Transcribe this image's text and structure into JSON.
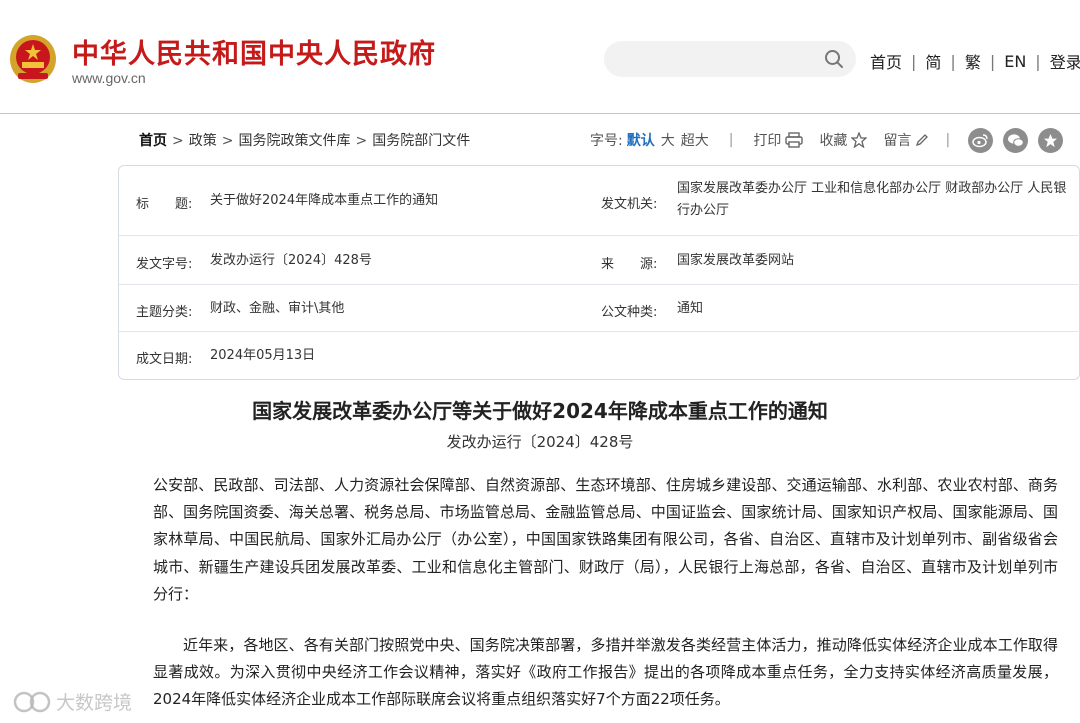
{
  "header": {
    "site_title": "中华人民共和国中央人民政府",
    "site_url": "www.gov.cn",
    "nav": [
      "首页",
      "简",
      "繁",
      "EN",
      "登录"
    ]
  },
  "breadcrumb": [
    "首页",
    "政策",
    "国务院政策文件库",
    "国务院部门文件"
  ],
  "toolbar": {
    "font_size_label": "字号:",
    "font_default": "默认",
    "font_large": "大",
    "font_xlarge": "超大",
    "print": "打印",
    "favorite": "收藏",
    "comment": "留言"
  },
  "info": {
    "title_label": "标　　题:",
    "title_value": "关于做好2024年降成本重点工作的通知",
    "issuer_label": "发文机关:",
    "issuer_value": "国家发展改革委办公厅 工业和信息化部办公厅 财政部办公厅 人民银行办公厅",
    "docno_label": "发文字号:",
    "docno_value": "发改办运行〔2024〕428号",
    "source_label": "来　　源:",
    "source_value": "国家发展改革委网站",
    "topic_label": "主题分类:",
    "topic_value": "财政、金融、审计\\其他",
    "type_label": "公文种类:",
    "type_value": "通知",
    "date_label": "成文日期:",
    "date_value": "2024年05月13日"
  },
  "article": {
    "title": "国家发展改革委办公厅等关于做好2024年降成本重点工作的通知",
    "doc_no": "发改办运行〔2024〕428号",
    "recipients": "公安部、民政部、司法部、人力资源社会保障部、自然资源部、生态环境部、住房城乡建设部、交通运输部、水利部、农业农村部、商务部、国务院国资委、海关总署、税务总局、市场监管总局、金融监管总局、中国证监会、国家统计局、国家知识产权局、国家能源局、国家林草局、中国民航局、国家外汇局办公厅（办公室），中国国家铁路集团有限公司，各省、自治区、直辖市及计划单列市、副省级省会城市、新疆生产建设兵团发展改革委、工业和信息化主管部门、财政厅（局），人民银行上海总部，各省、自治区、直辖市及计划单列市分行：",
    "body": "近年来，各地区、各有关部门按照党中央、国务院决策部署，多措并举激发各类经营主体活力，推动降低实体经济企业成本工作取得显著成效。为深入贯彻中央经济工作会议精神，落实好《政府工作报告》提出的各项降成本重点任务，全力支持实体经济高质量发展，2024年降低实体经济企业成本工作部际联席会议将重点组织落实好7个方面22项任务。"
  },
  "watermark": "大数跨境",
  "colors": {
    "brand_red": "#c41a1a",
    "link_blue": "#1f6fc2",
    "icon_gray": "#8d8d8d"
  }
}
